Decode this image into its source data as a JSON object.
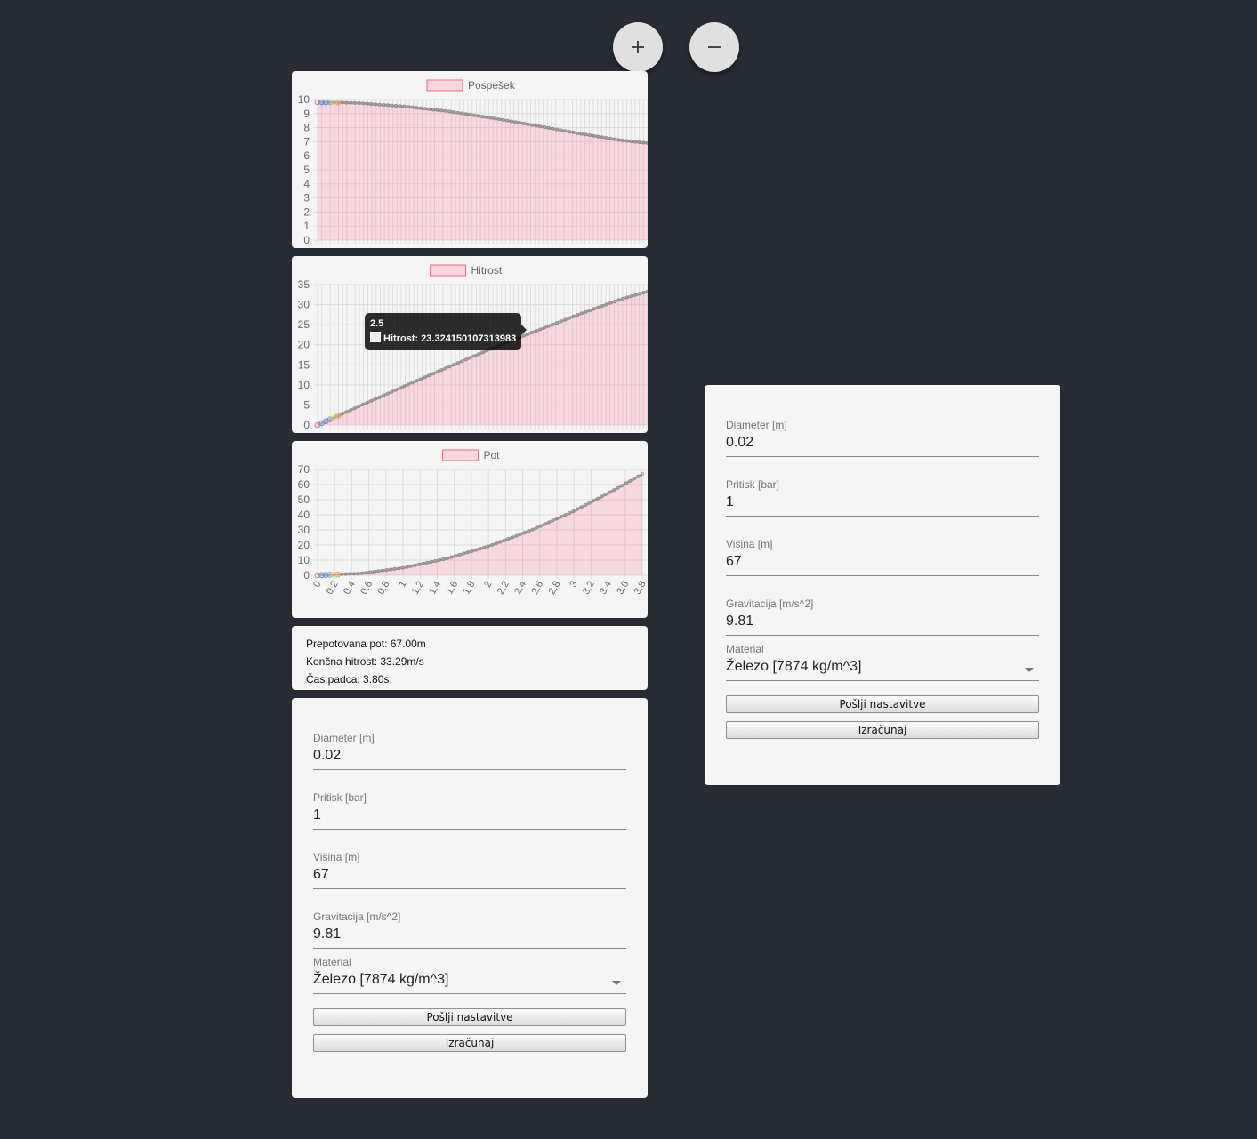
{
  "zoom": {
    "in_icon": "plus-icon",
    "out_icon": "minus-icon"
  },
  "colors": {
    "background": "#282c34",
    "card": "#f5f5f5",
    "series_fill": "rgba(255,99,132,0.2)",
    "series_border": "#ff6384"
  },
  "charts": [
    {
      "legend": "Pospešek",
      "yticks": [
        "0",
        "1",
        "2",
        "3",
        "4",
        "5",
        "6",
        "7",
        "8",
        "9",
        "10"
      ],
      "xticks": []
    },
    {
      "legend": "Hitrost",
      "yticks": [
        "0",
        "5",
        "10",
        "15",
        "20",
        "25",
        "30",
        "35"
      ],
      "xticks": []
    },
    {
      "legend": "Pot",
      "yticks": [
        "0",
        "10",
        "20",
        "30",
        "40",
        "50",
        "60",
        "70"
      ],
      "xticks": [
        "0",
        "0.2",
        "0.4",
        "0.6",
        "0.8",
        "1",
        "1.2",
        "1.4",
        "1.6",
        "1.8",
        "2",
        "2.2",
        "2.4",
        "2.6",
        "2.8",
        "3",
        "3.2",
        "3.4",
        "3.6",
        "3.8"
      ]
    }
  ],
  "chart_data": [
    {
      "type": "area",
      "x": [
        0,
        3.8
      ],
      "ylim": [
        0,
        10
      ],
      "grid": true,
      "legend_position": "top",
      "series": [
        {
          "name": "Pospešek",
          "x": [
            0,
            0.2,
            0.5,
            1.0,
            1.5,
            2.0,
            2.5,
            3.0,
            3.5,
            3.8
          ],
          "values": [
            9.81,
            9.8,
            9.74,
            9.51,
            9.17,
            8.7,
            8.16,
            7.6,
            7.1,
            6.9
          ]
        }
      ]
    },
    {
      "type": "area",
      "x": [
        0,
        3.8
      ],
      "ylim": [
        0,
        35
      ],
      "grid": true,
      "legend_position": "top",
      "series": [
        {
          "name": "Hitrost",
          "x": [
            0,
            0.5,
            1.0,
            1.5,
            2.0,
            2.5,
            3.0,
            3.5,
            3.8
          ],
          "values": [
            0,
            4.9,
            9.7,
            14.4,
            19.0,
            23.32,
            27.5,
            31.4,
            33.29
          ]
        }
      ],
      "tooltip": {
        "title": "2.5",
        "label": "Hitrost: 23.324150107313983"
      }
    },
    {
      "type": "area",
      "x": [
        0,
        3.8
      ],
      "ylim": [
        0,
        70
      ],
      "grid": true,
      "legend_position": "top",
      "series": [
        {
          "name": "Pot",
          "x": [
            0,
            0.5,
            1.0,
            1.5,
            2.0,
            2.5,
            3.0,
            3.5,
            3.8
          ],
          "values": [
            0,
            1.2,
            4.9,
            10.9,
            19.2,
            29.8,
            42.5,
            57.3,
            67.0
          ]
        }
      ]
    }
  ],
  "results": {
    "distance": "Prepotovana pot: 67.00m",
    "speed": "Končna hitrost: 33.29m/s",
    "time": "Čas padca: 3.80s"
  },
  "form": {
    "diameter_label": "Diameter [m]",
    "diameter_value": "0.02",
    "pressure_label": "Pritisk [bar]",
    "pressure_value": "1",
    "height_label": "Višina [m]",
    "height_value": "67",
    "gravity_label": "Gravitacija [m/s^2]",
    "gravity_value": "9.81",
    "material_label": "Material",
    "material_value": "Železo [7874 kg/m^3]",
    "send_button": "Pošlji nastavitve",
    "calc_button": "Izračunaj"
  }
}
